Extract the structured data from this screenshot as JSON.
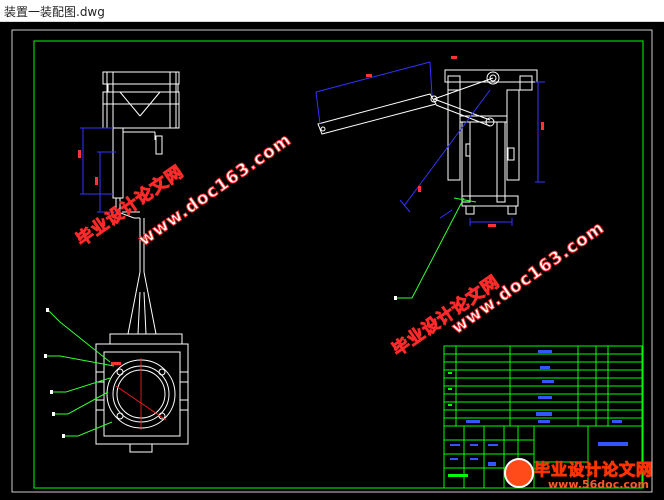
{
  "window": {
    "title": "装置一装配图.dwg"
  },
  "watermarks": {
    "cn_text": "毕业设计论文网",
    "url_text": "www.doc163.com"
  },
  "logo": {
    "cn_text": "毕业设计论文网",
    "url_text": "www.56doc.com"
  },
  "colors": {
    "canvas_bg": "#000000",
    "frame": "#00ff00",
    "geometry": "#ffffff",
    "dimension": "#3333ff",
    "dimension_text": "#ff3333",
    "centerline": "#ff2222",
    "leader": "#33ff33",
    "watermark_outline": "#ff2a2a",
    "watermark_fill": "#ffffff"
  }
}
